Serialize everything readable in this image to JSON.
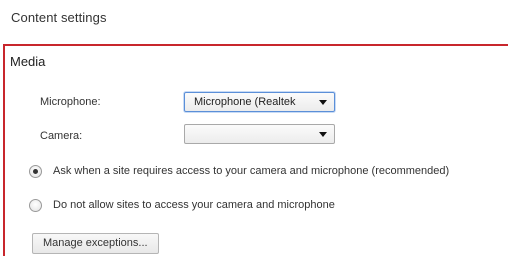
{
  "page": {
    "title": "Content settings"
  },
  "media": {
    "title": "Media",
    "microphone": {
      "label": "Microphone:",
      "selected": "Microphone (Realtek"
    },
    "camera": {
      "label": "Camera:",
      "selected": ""
    },
    "options": [
      {
        "label": "Ask when a site requires access to your camera and microphone (recommended)",
        "checked": true
      },
      {
        "label": "Do not allow sites to access your camera and microphone",
        "checked": false
      }
    ],
    "manage_button": "Manage exceptions..."
  },
  "icons": {
    "dropdown": "chevron-down-icon",
    "radio": "radio-icon"
  },
  "colors": {
    "highlight_border": "#c8262c",
    "focus_border": "#5b8fd8"
  }
}
